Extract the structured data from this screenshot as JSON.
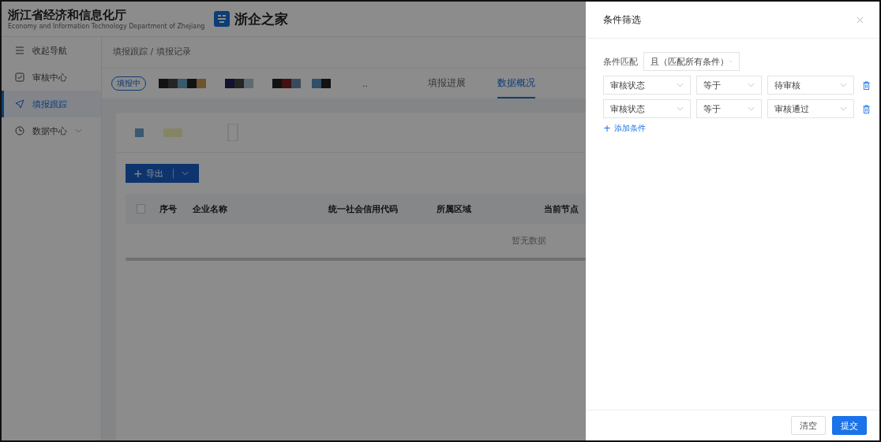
{
  "header": {
    "title": "浙江省经济和信息化厅",
    "subtitle": "Economy and Information Technology Department of Zhejiang",
    "brand": "浙企之家"
  },
  "sidebar": {
    "items": [
      {
        "label": "收起导航",
        "kind": "menu",
        "selected": false
      },
      {
        "label": "审核中心",
        "kind": "check",
        "selected": false
      },
      {
        "label": "填报跟踪",
        "kind": "send",
        "selected": true
      },
      {
        "label": "数据中心",
        "kind": "clock",
        "selected": false,
        "expandable": true
      }
    ]
  },
  "breadcrumb": "填报跟踪 / 填报记录",
  "status_tag": "填报中",
  "more": "..",
  "tabs": [
    {
      "label": "填报进展",
      "selected": false
    },
    {
      "label": "数据概况",
      "selected": true
    }
  ],
  "export_button": {
    "icon": "+",
    "label": "导出"
  },
  "table": {
    "select_all_checked": false,
    "columns": [
      "序号",
      "企业名称",
      "统一社会信用代码",
      "所属区域",
      "当前节点"
    ],
    "empty_text": "暂无数据"
  },
  "drawer": {
    "title": "条件筛选",
    "match_label": "条件匹配",
    "match_value": "且（匹配所有条件）",
    "conditions": [
      {
        "field": "审核状态",
        "operator": "等于",
        "value": "待审核"
      },
      {
        "field": "审核状态",
        "operator": "等于",
        "value": "审核通过"
      }
    ],
    "add_icon": "+",
    "add_label": "添加条件",
    "buttons": [
      {
        "label": "清空",
        "kind": "secondary"
      },
      {
        "label": "提交",
        "kind": "primary"
      }
    ]
  }
}
